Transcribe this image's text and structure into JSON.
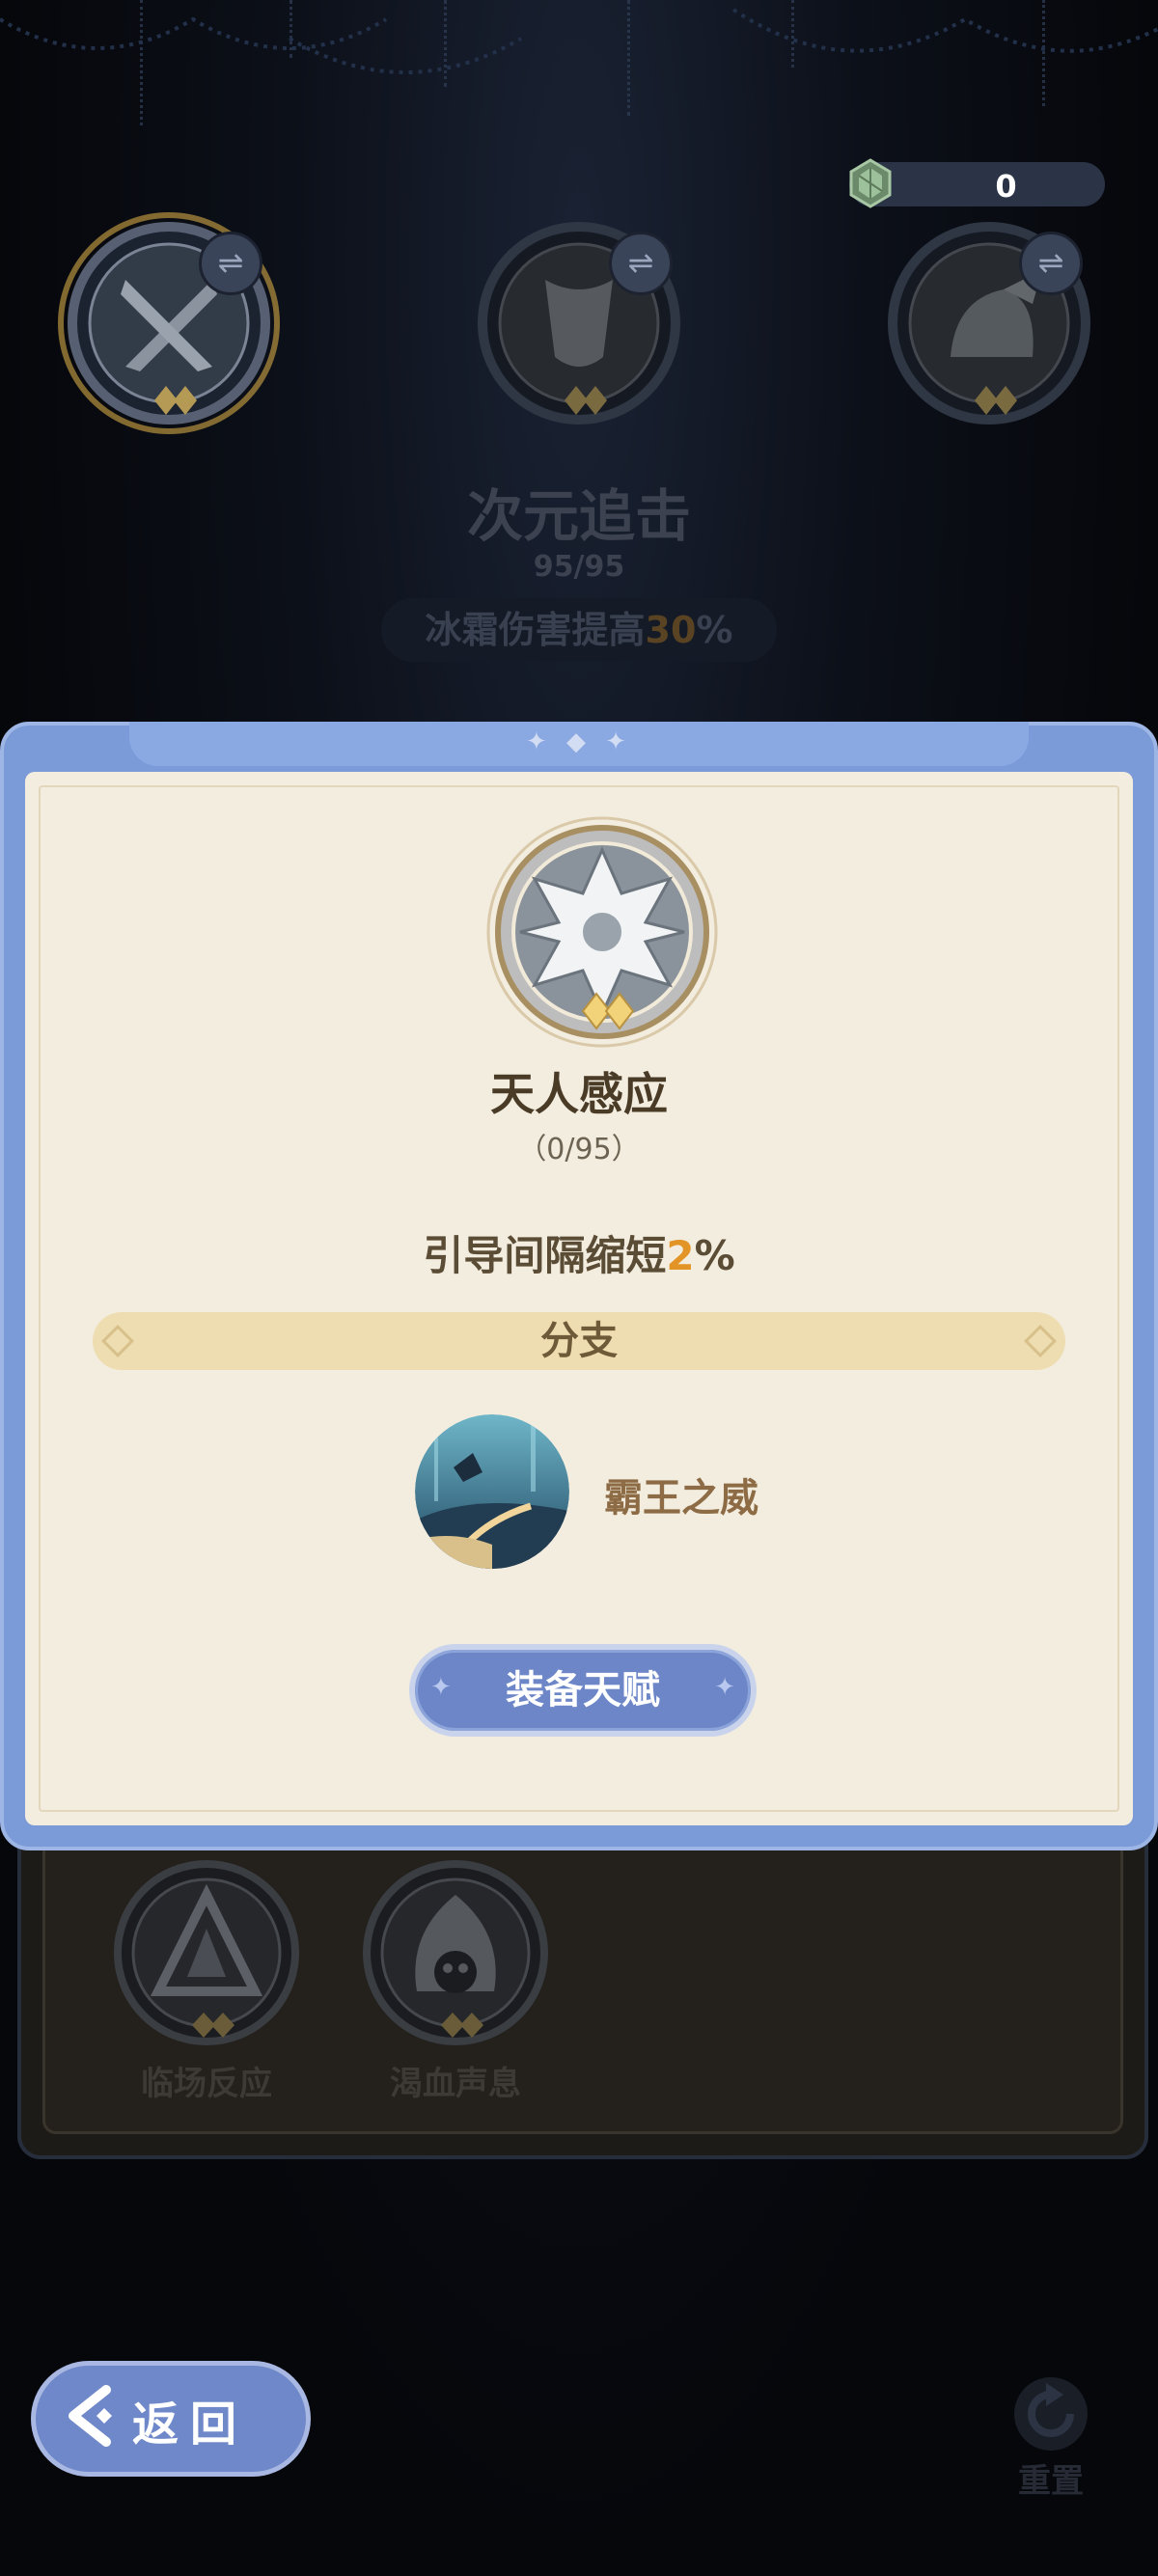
{
  "currency": {
    "icon": "crystal-gem-icon",
    "amount": "0"
  },
  "top_slots": [
    {
      "icon": "crossed-swords-icon",
      "selected": true,
      "swap_icon": "swap-arrows-icon",
      "swap_glyph": "⇌"
    },
    {
      "icon": "shield-crest-icon",
      "selected": false,
      "swap_icon": "swap-arrows-icon",
      "swap_glyph": "⇌"
    },
    {
      "icon": "winged-helmet-icon",
      "selected": false,
      "swap_icon": "swap-arrows-icon",
      "swap_glyph": "⇌"
    }
  ],
  "current_talent": {
    "name": "次元追击",
    "progress": "95/95",
    "effect_prefix": "冰霜伤害提高",
    "effect_value": "30",
    "effect_suffix": "%"
  },
  "popup": {
    "medal_icon": "snowflake-cross-icon",
    "title": "天人感应",
    "progress": "（0/95）",
    "effect_prefix": "引导间隔缩短",
    "effect_value": "2",
    "effect_suffix": "%",
    "branch_header": "分支",
    "branch": {
      "icon": "mountain-night-landscape-icon",
      "name": "霸王之威"
    },
    "equip_label": "装备天赋",
    "top_ornament": "✦ ◆ ✦"
  },
  "lower_talents": [
    {
      "label": "临场反应",
      "icon": "triangle-crest-icon"
    },
    {
      "label": "渴血声息",
      "icon": "skull-hood-icon"
    }
  ],
  "back_button": {
    "label": "返回"
  },
  "reset_button": {
    "label": "重置",
    "icon": "reset-arrow-icon"
  },
  "colors": {
    "accent_blue": "#6f88c9",
    "highlight_orange": "#e39427",
    "gold_ring": "#e8b84a"
  }
}
